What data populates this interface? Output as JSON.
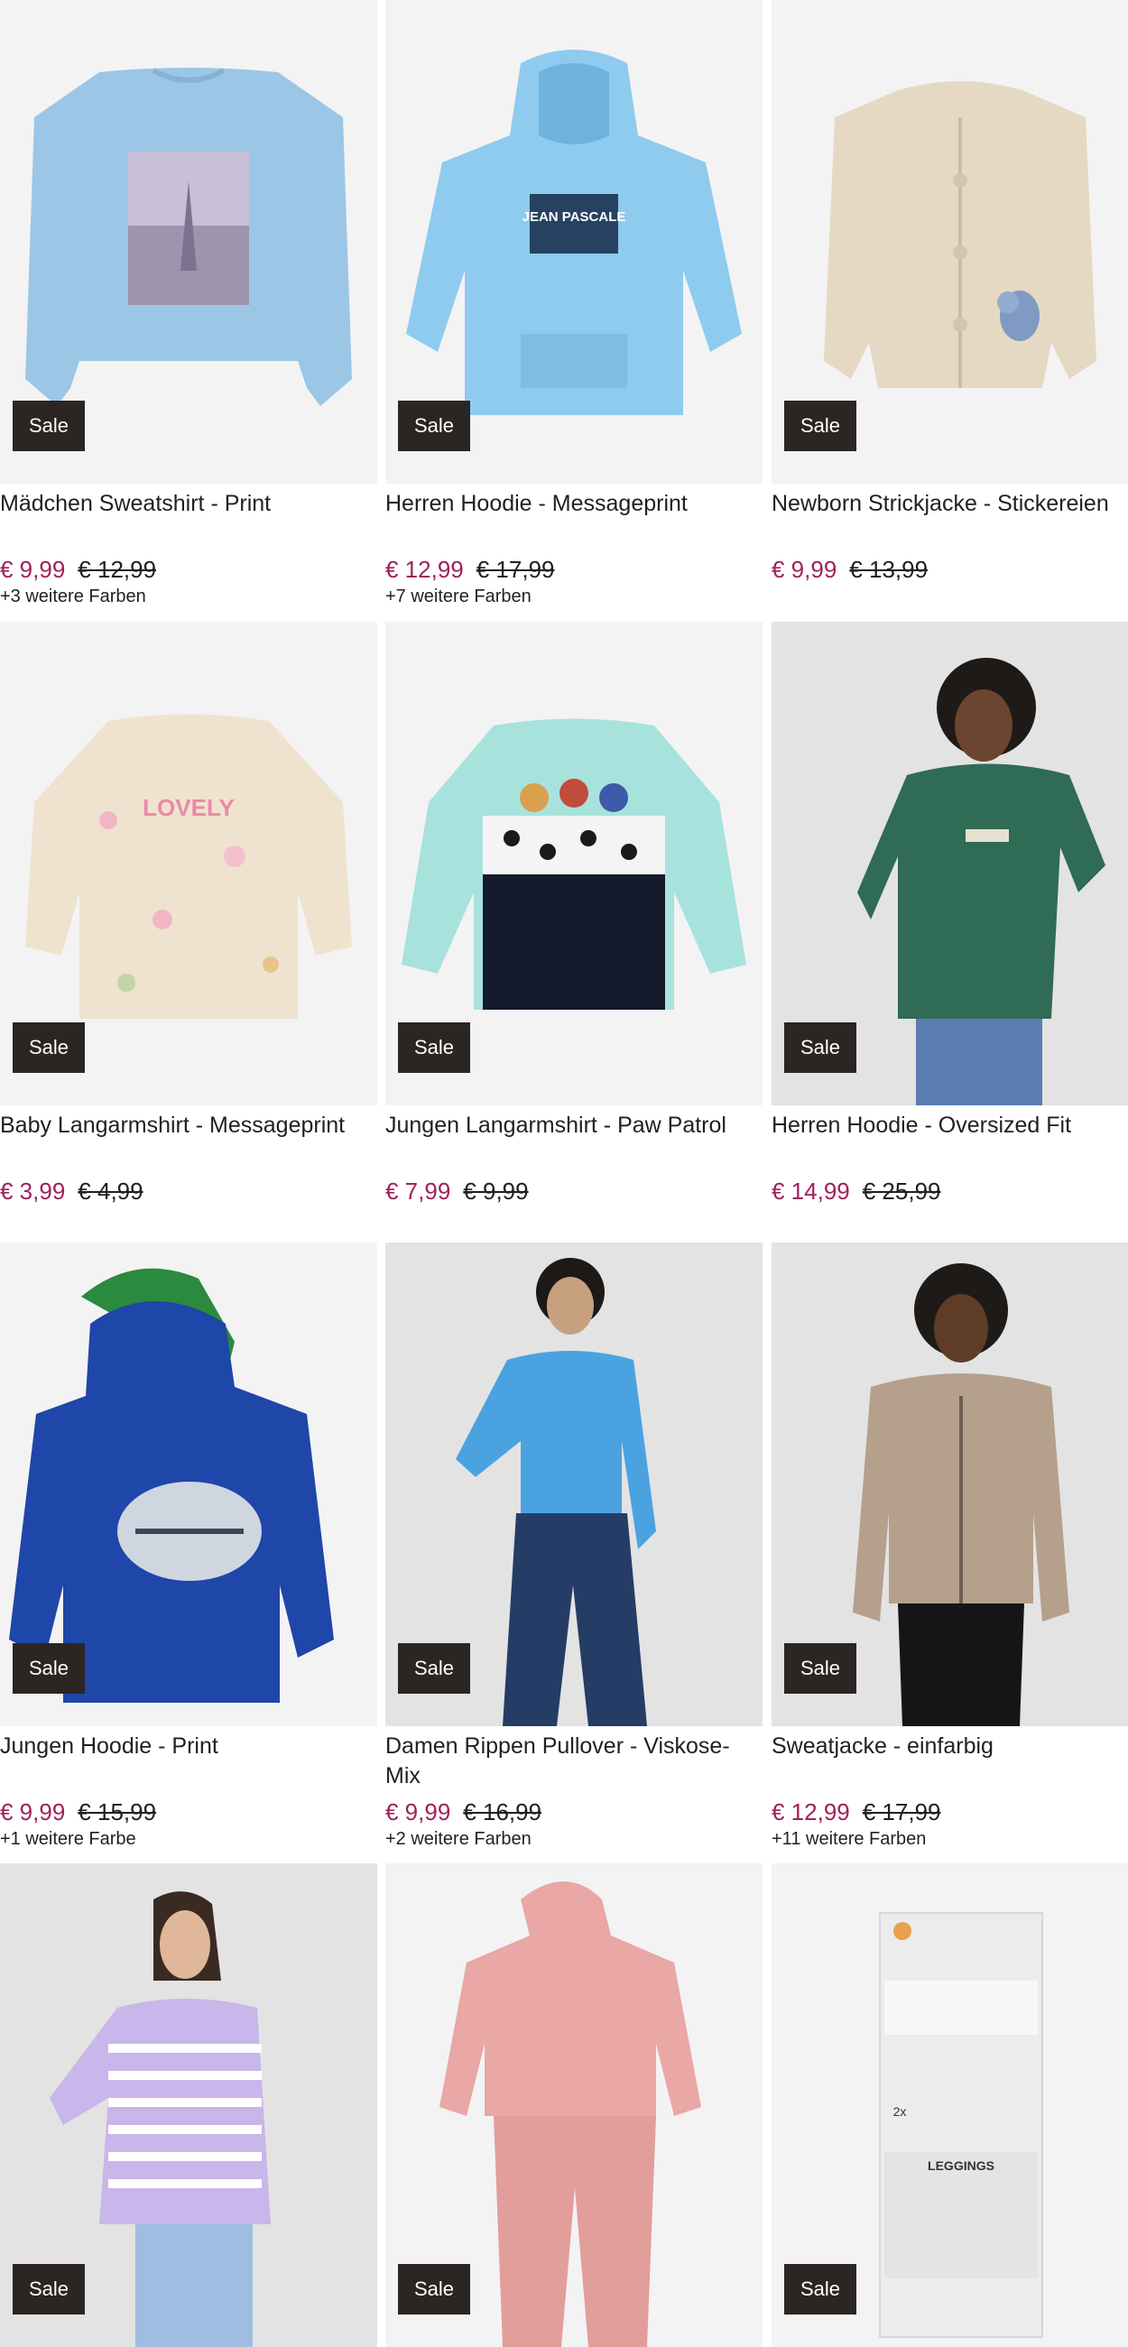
{
  "products": [
    {
      "title": "Mädchen Sweatshirt - Print",
      "badge": "Sale",
      "price": "€ 9,99",
      "old_price": "€ 12,99",
      "colors": "+3 weitere Farben"
    },
    {
      "title": "Herren Hoodie - Messageprint",
      "badge": "Sale",
      "price": "€ 12,99",
      "old_price": "€ 17,99",
      "colors": "+7 weitere Farben",
      "print_text": "JEAN PASCALE"
    },
    {
      "title": "Newborn Strickjacke - Stickereien",
      "badge": "Sale",
      "price": "€ 9,99",
      "old_price": "€ 13,99",
      "colors": ""
    },
    {
      "title": "Baby Langarmshirt - Messageprint",
      "badge": "Sale",
      "price": "€ 3,99",
      "old_price": "€ 4,99",
      "colors": "",
      "print_text": "LOVELY"
    },
    {
      "title": "Jungen Langarmshirt - Paw Patrol",
      "badge": "Sale",
      "price": "€ 7,99",
      "old_price": "€ 9,99",
      "colors": ""
    },
    {
      "title": "Herren Hoodie - Oversized Fit",
      "badge": "Sale",
      "price": "€ 14,99",
      "old_price": "€ 25,99",
      "colors": ""
    },
    {
      "title": "Jungen Hoodie - Print",
      "badge": "Sale",
      "price": "€ 9,99",
      "old_price": "€ 15,99",
      "colors": "+1 weitere Farbe"
    },
    {
      "title": "Damen Rippen Pullover - Viskose-Mix",
      "badge": "Sale",
      "price": "€ 9,99",
      "old_price": "€ 16,99",
      "colors": "+2 weitere Farben"
    },
    {
      "title": "Sweatjacke - einfarbig",
      "badge": "Sale",
      "price": "€ 12,99",
      "old_price": "€ 17,99",
      "colors": "+11 weitere Farben"
    },
    {
      "title": "",
      "badge": "Sale",
      "price": "",
      "old_price": "",
      "colors": ""
    },
    {
      "title": "",
      "badge": "Sale",
      "price": "",
      "old_price": "",
      "colors": ""
    },
    {
      "title": "",
      "badge": "Sale",
      "price": "",
      "old_price": "",
      "colors": "",
      "print_text": "LEGGINGS",
      "pack_text": "2x"
    }
  ],
  "colors": {
    "sale_price": "#a1215a",
    "badge_bg": "#2b2523",
    "text": "#231f20",
    "image_bg": "#f3f3f3"
  }
}
